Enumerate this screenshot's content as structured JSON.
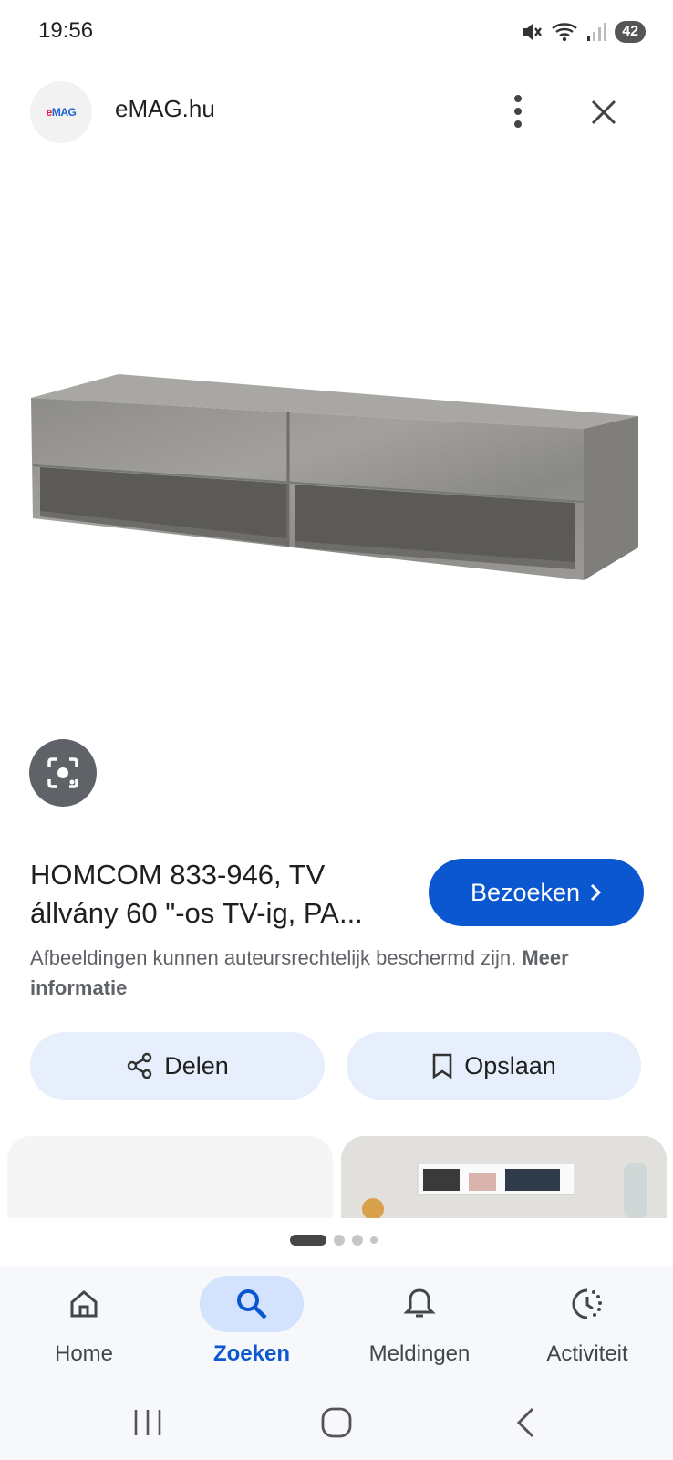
{
  "status_bar": {
    "time": "19:56",
    "battery": "42"
  },
  "header": {
    "site_name": "eMAG.hu",
    "logo_text_left": "e",
    "logo_text_right": "MAG"
  },
  "result": {
    "title": "HOMCOM 833-946, TV állvány 60 \"-os TV-ig, PA...",
    "visit_label": "Bezoeken",
    "copyright_text": "Afbeeldingen kunnen auteursrechtelijk beschermd zijn.",
    "more_info_label": "Meer informatie"
  },
  "actions": {
    "share_label": "Delen",
    "save_label": "Opslaan"
  },
  "bottom_nav": [
    {
      "label": "Home",
      "icon": "home-icon"
    },
    {
      "label": "Zoeken",
      "icon": "search-icon"
    },
    {
      "label": "Meldingen",
      "icon": "bell-icon"
    },
    {
      "label": "Activiteit",
      "icon": "activity-icon"
    }
  ],
  "active_nav": "Zoeken",
  "colors": {
    "accent": "#0b57d0",
    "action_bg": "#e8effc",
    "nav_bg": "#f6f8fc"
  },
  "carousel": {
    "pages": 4,
    "current": 1
  }
}
